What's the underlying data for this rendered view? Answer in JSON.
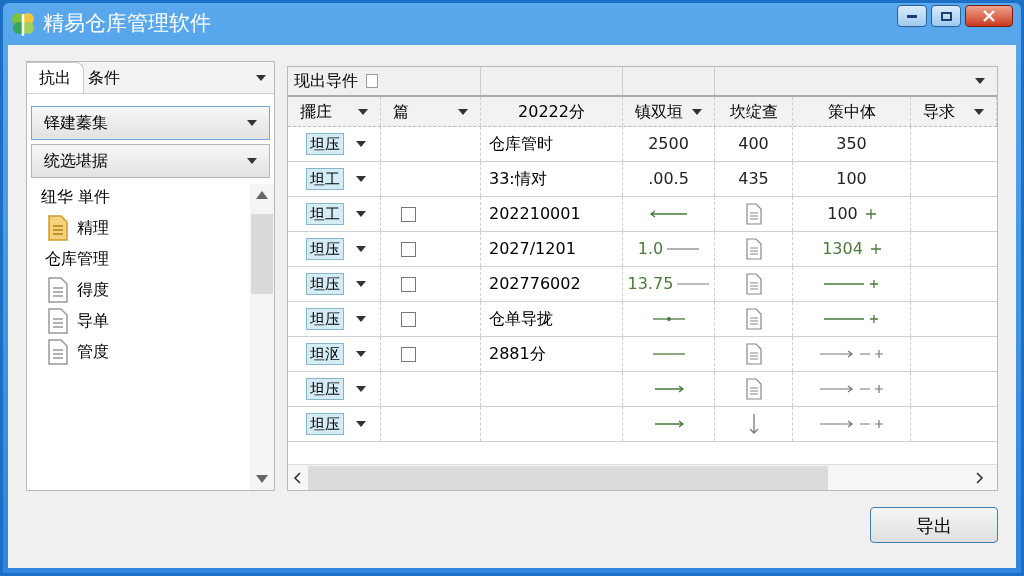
{
  "window": {
    "title": "精易仓库管理软件"
  },
  "left_panel": {
    "tab": {
      "label": "抗出",
      "selected": true
    },
    "tab_label": "条件",
    "combos": [
      {
        "value": "铎建蓁集",
        "focused": true
      },
      {
        "value": "统选堪据",
        "focused": false
      }
    ],
    "tree": {
      "header": "纽华 単件",
      "items": [
        {
          "label": "精理",
          "kind": "folder"
        },
        {
          "label": "仓库管理",
          "kind": "plain"
        },
        {
          "label": "得度",
          "kind": "doc"
        },
        {
          "label": "导单",
          "kind": "doc"
        },
        {
          "label": "管度",
          "kind": "doc"
        }
      ]
    }
  },
  "table": {
    "toolbar_label": "现出导件",
    "columns": [
      {
        "label": "擺庄",
        "dropdown": true
      },
      {
        "label": "篇",
        "dropdown": true
      },
      {
        "label": "20222分",
        "dropdown": false
      },
      {
        "label": "镇双垣",
        "dropdown": true
      },
      {
        "label": "坎绽查",
        "dropdown": false
      },
      {
        "label": "策中体",
        "dropdown": false
      },
      {
        "label": "导求",
        "dropdown": true
      }
    ],
    "rows": [
      {
        "tag": "坦压",
        "col3": "仓库管时",
        "col4": {
          "kind": "text",
          "text": "2500",
          "color": "#222222"
        },
        "col5": {
          "kind": "text",
          "text": "400"
        },
        "col6": {
          "kind": "text",
          "text": "350",
          "color": "#222222"
        }
      },
      {
        "tag": "坦工",
        "col3": "33:情对",
        "col4": {
          "kind": "text",
          "text": ".00.5",
          "color": "#222222"
        },
        "col5": {
          "kind": "text",
          "text": "435"
        },
        "col6": {
          "kind": "text",
          "text": "100",
          "color": "#222222"
        }
      },
      {
        "tag": "坦工",
        "checked": false,
        "col3": "202210001",
        "col4": {
          "kind": "arrow-left"
        },
        "col5": {
          "kind": "doc"
        },
        "col6": {
          "kind": "text-plus",
          "text": "100",
          "color": "#222222"
        }
      },
      {
        "tag": "坦压",
        "checked": false,
        "col3": "2027/1201",
        "col4": {
          "kind": "text-line",
          "text": "1.0",
          "color": "#4a7a3a"
        },
        "col5": {
          "kind": "doc"
        },
        "col6": {
          "kind": "text-plus",
          "text": "1304",
          "color": "#4a7a3a"
        }
      },
      {
        "tag": "坦压",
        "checked": false,
        "col3": "202776002",
        "col4": {
          "kind": "text-line",
          "text": "13.75",
          "color": "#4a7a3a"
        },
        "col5": {
          "kind": "doc"
        },
        "col6": {
          "kind": "line-plus"
        }
      },
      {
        "tag": "坦压",
        "checked": false,
        "col3": "仓单导拢",
        "col4": {
          "kind": "dot-line"
        },
        "col5": {
          "kind": "doc"
        },
        "col6": {
          "kind": "line-plus"
        }
      },
      {
        "tag": "坦沤",
        "checked": false,
        "col3": "2881分",
        "col4": {
          "kind": "line"
        },
        "col5": {
          "kind": "doc"
        },
        "col6": {
          "kind": "arrow-plus"
        }
      },
      {
        "tag": "坦压",
        "col3": "",
        "col4": {
          "kind": "arrow-right"
        },
        "col5": {
          "kind": "doc"
        },
        "col6": {
          "kind": "arrow-plus"
        }
      },
      {
        "tag": "坦压",
        "col3": "",
        "col4": {
          "kind": "arrow-right"
        },
        "col5": {
          "kind": "down-arrow"
        },
        "col6": {
          "kind": "arrow-plus"
        }
      }
    ]
  },
  "buttons": [
    {
      "label": "导出"
    }
  ]
}
